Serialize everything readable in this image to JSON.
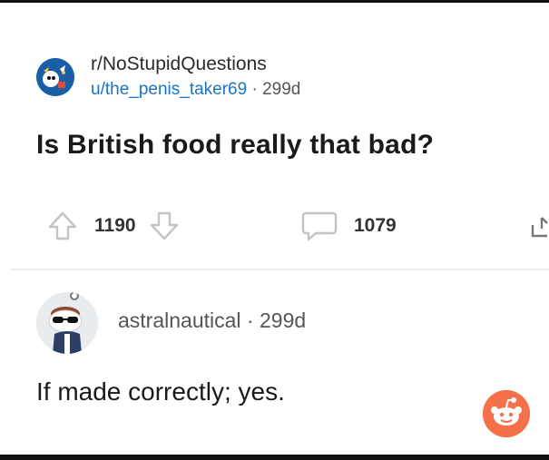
{
  "post": {
    "subreddit": "r/NoStupidQuestions",
    "author": "u/the_penis_taker69",
    "separator": "·",
    "age": "299d",
    "title": "Is British food really that bad?",
    "score": "1190",
    "comments": "1079"
  },
  "comment": {
    "author": "astralnautical",
    "separator": "·",
    "age": "299d",
    "body": "If made correctly; yes."
  },
  "icons": {
    "upvote": "upvote-arrow-icon",
    "downvote": "downvote-arrow-icon",
    "comment": "comment-bubble-icon",
    "share": "share-icon",
    "reddit": "snoo-icon"
  },
  "colors": {
    "username": "#1a73c9",
    "accent": "#f4714a",
    "subreddit_avatar": "#1b5ea8"
  }
}
